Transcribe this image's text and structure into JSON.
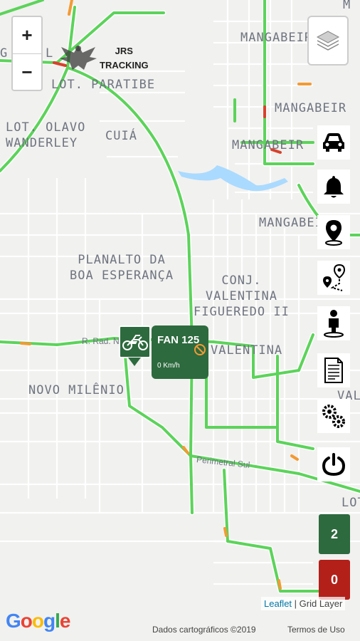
{
  "map": {
    "labels": {
      "mangabeira_top": "MANGABEIRA",
      "lot_paratibe": "LOT. PARATIBE",
      "mangabeira_2": "MANGABEIR",
      "lot_olavo": "LOT. OLAVO\nWANDERLEY",
      "cuia": "CUIÁ",
      "mangabeira_3": "MANGABEIR",
      "mangabeira_4": "MANGABEI",
      "planalto": "PLANALTO DA\nBOA ESPERANÇA",
      "conj_valentina": "CONJ.\nVALENTINA\nFIGUEREDO II",
      "valentina": "VALENTINA",
      "novo_milenio": "NOVO MILÊNIO",
      "val": "VAL",
      "lot_right": "LOT",
      "road_rad": "R. Rad. N",
      "perimetral": "Perimetral Sul",
      "top_left_g": "G",
      "top_left_l": "L",
      "top_right_m": "M"
    }
  },
  "zoom": {
    "in": "+",
    "out": "−"
  },
  "brand": {
    "name_line1": "JRS",
    "name_line2": "TRACKING"
  },
  "vehicle": {
    "name": "FAN 125",
    "speed": "0 Km/h"
  },
  "sidebar": {
    "items": [
      {
        "icon": "car-icon"
      },
      {
        "icon": "bell-icon"
      },
      {
        "icon": "location-pin-icon"
      },
      {
        "icon": "route-icon"
      },
      {
        "icon": "person-pin-icon"
      },
      {
        "icon": "document-icon"
      },
      {
        "icon": "gears-icon"
      },
      {
        "icon": "power-icon"
      }
    ]
  },
  "badges": {
    "online": {
      "count": "2",
      "color": "#2d6a3e"
    },
    "offline": {
      "count": "0",
      "color": "#b3201a"
    }
  },
  "attribution": {
    "leaflet": "Leaflet",
    "separator": " | ",
    "grid": "Grid Layer"
  },
  "google": {
    "logo_text": "Google",
    "map_data": "Dados cartográficos ©2019",
    "terms": "Termos de Uso"
  },
  "colors": {
    "road_green": "#5cd35a",
    "road_orange": "#f39a33",
    "road_red": "#d8412c"
  }
}
